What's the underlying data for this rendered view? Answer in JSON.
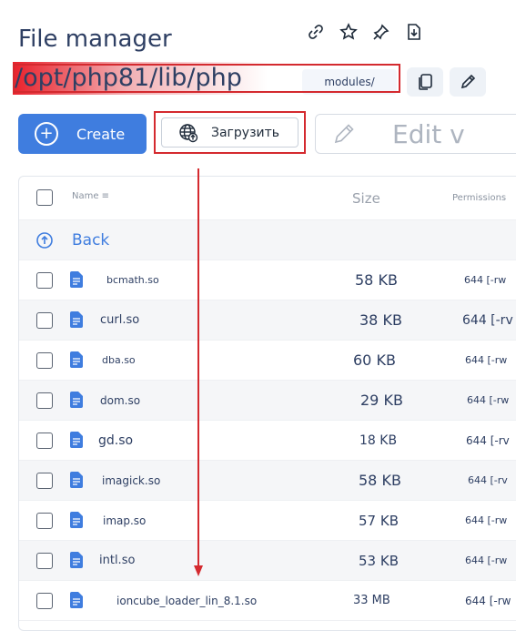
{
  "header": {
    "title": "File manager",
    "path": "/opt/php81/lib/php",
    "modules_label": "modules/"
  },
  "top_icons": [
    "link-icon",
    "star-icon",
    "pin-icon",
    "download-icon"
  ],
  "toolbar": {
    "create_label": "Create",
    "upload_label": "Загрузить",
    "edit_label": "Edit v"
  },
  "table": {
    "columns": {
      "name": "Name ≡",
      "size": "Size",
      "permissions": "Permissions"
    },
    "back_label": "Back",
    "rows": [
      {
        "name": "bcmath.so",
        "size": "58 KB",
        "perm": "644 [-rw"
      },
      {
        "name": "curl.so",
        "size": "38 KB",
        "perm": "644 [-rv"
      },
      {
        "name": "dba.so",
        "size": "60 KB",
        "perm": "644 [-rw"
      },
      {
        "name": "dom.so",
        "size": "29 KB",
        "perm": "644 [-rw"
      },
      {
        "name": "gd.so",
        "size": "18 KB",
        "perm": "644 [-rv"
      },
      {
        "name": "imagick.so",
        "size": "58 KB",
        "perm": "644 [-rv"
      },
      {
        "name": "imap.so",
        "size": "57 KB",
        "perm": "644 [-rw"
      },
      {
        "name": "intl.so",
        "size": "53 KB",
        "perm": "644 [-rw"
      },
      {
        "name": "ioncube_loader_lin_8.1.so",
        "size": "33 MB",
        "perm": "644 [-rw"
      }
    ]
  },
  "colors": {
    "accent": "#3f7ddf",
    "highlight": "#d42a2f",
    "file_icon": "#3f7ddf"
  }
}
